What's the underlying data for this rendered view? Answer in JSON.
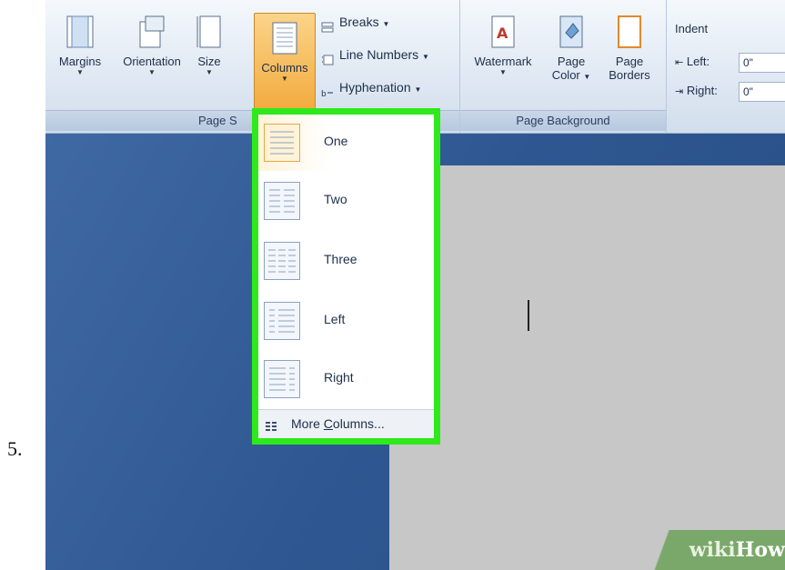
{
  "step": "5.",
  "ribbon": {
    "page_setup": {
      "margins": "Margins",
      "orientation": "Orientation",
      "size": "Size",
      "columns": "Columns",
      "breaks": "Breaks",
      "line_numbers": "Line Numbers",
      "hyphenation": "Hyphenation",
      "group_label": "Page S"
    },
    "page_background": {
      "watermark": "Watermark",
      "page_color_1": "Page",
      "page_color_2": "Color",
      "page_borders_1": "Page",
      "page_borders_2": "Borders",
      "group_label": "Page Background"
    },
    "indent": {
      "title": "Indent",
      "left_label": "Left:",
      "left_value": "0\"",
      "right_label": "Right:",
      "right_value": "0\""
    }
  },
  "columns_menu": {
    "items": [
      {
        "label": "One"
      },
      {
        "label": "Two"
      },
      {
        "label": "Three"
      },
      {
        "label": "Left"
      },
      {
        "label": "Right"
      }
    ],
    "more_prefix": "More ",
    "more_underlined": "C",
    "more_suffix": "olumns...",
    "selected": "One",
    "highlight_color": "#2ee91b"
  },
  "watermark": {
    "wiki": "wiki",
    "how": "How"
  }
}
